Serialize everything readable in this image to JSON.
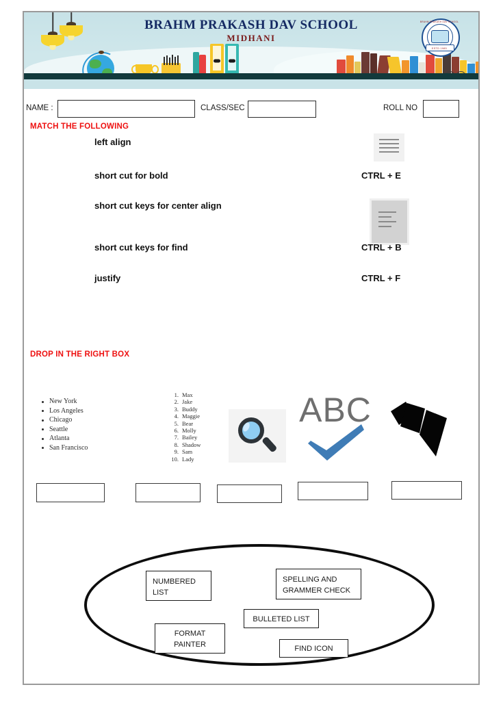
{
  "page": {
    "school_name": "BRAHM PRAKASH DAV SCHOOL",
    "school_branch": "MIDHANI",
    "logo_top_text": "BRAHM PRAKASH DAV SCHOOL",
    "logo_bottom_text": "ESTD 1985"
  },
  "student_fields": {
    "name_label": "NAME :",
    "name_value": "",
    "class_label": "CLASS/SEC",
    "class_value": "",
    "roll_label": "ROLL NO",
    "roll_value": ""
  },
  "section_match": {
    "heading": "MATCH THE FOLLOWING",
    "left_items": [
      "left align",
      "short cut for bold",
      "short cut keys for center align",
      "short cut keys for find",
      "justify"
    ],
    "right_items": [
      {
        "type": "icon",
        "icon": "align-justify-icon",
        "text": ""
      },
      {
        "type": "text",
        "icon": "",
        "text": "CTRL + E"
      },
      {
        "type": "icon",
        "icon": "align-left-icon",
        "text": ""
      },
      {
        "type": "text",
        "icon": "",
        "text": "CTRL + B"
      },
      {
        "type": "text",
        "icon": "",
        "text": "CTRL + F"
      }
    ]
  },
  "section_drop": {
    "heading": "DROP IN THE RIGHT BOX",
    "bulleted_list": [
      "New York",
      "Los Angeles",
      "Chicago",
      "Seattle",
      "Atlanta",
      "San Francisco"
    ],
    "numbered_list": [
      "Max",
      "Jake",
      "Buddy",
      "Maggie",
      "Bear",
      "Molly",
      "Bailey",
      "Shadow",
      "Sam",
      "Lady"
    ],
    "icons": [
      {
        "name": "find-magnifier-icon",
        "label": ""
      },
      {
        "name": "spelling-grammar-abc-check-icon",
        "label": "ABC"
      },
      {
        "name": "format-painter-brush-icon",
        "label": ""
      }
    ],
    "answer_boxes": [
      "",
      "",
      "",
      "",
      ""
    ]
  },
  "section_wordbank": {
    "items": [
      {
        "line1": "NUMBERED",
        "line2": "LIST"
      },
      {
        "line1": "SPELLING AND",
        "line2": "GRAMMER CHECK"
      },
      {
        "line1": "BULLETED LIST",
        "line2": ""
      },
      {
        "line1": "FORMAT",
        "line2": "PAINTER"
      },
      {
        "line1": "FIND ICON",
        "line2": ""
      }
    ]
  },
  "colors": {
    "heading_red": "#ee1111",
    "title_navy": "#152a63",
    "subtitle_maroon": "#7a1b1b",
    "banner_bg": "#c9e3e8",
    "page_border": "#9a9a9a"
  }
}
